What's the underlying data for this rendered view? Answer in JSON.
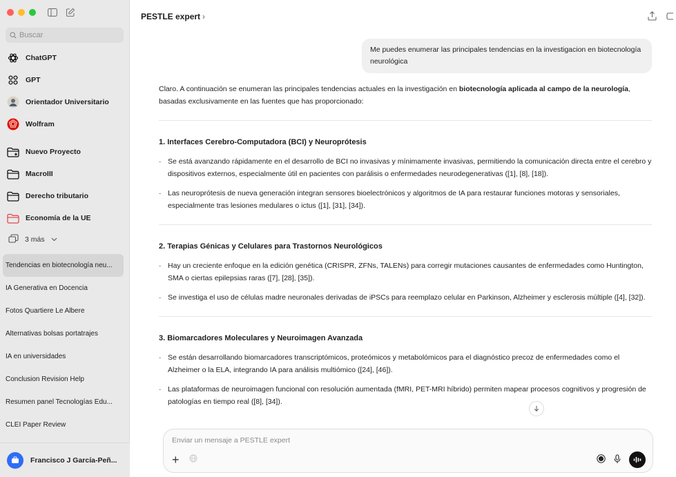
{
  "window": {
    "traffic_lights": [
      "#ff5f57",
      "#febc2e",
      "#28c840"
    ]
  },
  "sidebar": {
    "search_placeholder": "Buscar",
    "items": [
      {
        "label": "ChatGPT",
        "icon": "openai-logo-icon"
      },
      {
        "label": "GPT",
        "icon": "gpts-grid-icon"
      },
      {
        "label": "Orientador Universitario",
        "icon": "orientador-avatar-icon"
      },
      {
        "label": "Wolfram",
        "icon": "wolfram-logo-icon"
      }
    ],
    "projects": [
      {
        "label": "Nuevo Proyecto",
        "icon": "folder-plus-icon"
      },
      {
        "label": "MacroIII",
        "icon": "folder-icon"
      },
      {
        "label": "Derecho tributario",
        "icon": "folder-icon"
      },
      {
        "label": "Economía de la UE",
        "icon": "folder-red-icon"
      }
    ],
    "more_label": "3 más",
    "history": [
      "Tendencias en biotecnología neu...",
      "IA Generativa en Docencia",
      "Fotos Quartiere Le Albere",
      "Alternativas bolsas portatrajes",
      "IA en universidades",
      "Conclusion Revision Help",
      "Resumen panel Tecnologías Edu...",
      "CLEI Paper Review"
    ],
    "user_name": "Francisco J García-Peñ..."
  },
  "header": {
    "title": "PESTLE expert",
    "chevron": "›"
  },
  "conversation": {
    "user_message": "Me puedes enumerar las principales tendencias en la investigacion en biotecnología neurológica",
    "intro_part1": "Claro. A continuación se enumeran las principales tendencias actuales en la investigación en ",
    "intro_bold": "biotecnología aplicada al campo de la neurología",
    "intro_part2": ", basadas exclusivamente en las fuentes que has proporcionado:",
    "sections": [
      {
        "title": "1. Interfaces Cerebro-Computadora (BCI) y Neuroprótesis",
        "bullets": [
          "Se está avanzando rápidamente en el desarrollo de BCI no invasivas y mínimamente invasivas, permitiendo la comunicación directa entre el cerebro y dispositivos externos, especialmente útil en pacientes con parálisis o enfermedades neurodegenerativas ([1], [8], [18]).",
          "Las neuroprótesis de nueva generación integran sensores bioelectrónicos y algoritmos de IA para restaurar funciones motoras y sensoriales, especialmente tras lesiones medulares o ictus ([1], [31], [34])."
        ]
      },
      {
        "title": "2. Terapias Génicas y Celulares para Trastornos Neurológicos",
        "bullets": [
          "Hay un creciente enfoque en la edición genética (CRISPR, ZFNs, TALENs) para corregir mutaciones causantes de enfermedades como Huntington, SMA o ciertas epilepsias raras ([7], [28], [35]).",
          "Se investiga el uso de células madre neuronales derivadas de iPSCs para reemplazo celular en Parkinson, Alzheimer y esclerosis múltiple ([4], [32])."
        ]
      },
      {
        "title": "3. Biomarcadores Moleculares y Neuroimagen Avanzada",
        "bullets": [
          "Se están desarrollando biomarcadores transcriptómicos, proteómicos y metabolómicos para el diagnóstico precoz de enfermedades como el Alzheimer o la ELA, integrando IA para análisis multiómico ([24], [46]).",
          "Las plataformas de neuroimagen funcional con resolución aumentada (fMRI, PET-MRI híbrido) permiten mapear procesos cognitivos y progresión de patologías en tiempo real ([8], [34])."
        ]
      }
    ],
    "bullet_char": "·"
  },
  "composer": {
    "placeholder": "Enviar un mensaje a PESTLE expert",
    "plus": "+"
  },
  "colors": {
    "sidebar_bg": "#e9e9e9",
    "accent_blue": "#2f6df6",
    "wolfram_red": "#dd1100",
    "folder_red": "#e5484d"
  }
}
